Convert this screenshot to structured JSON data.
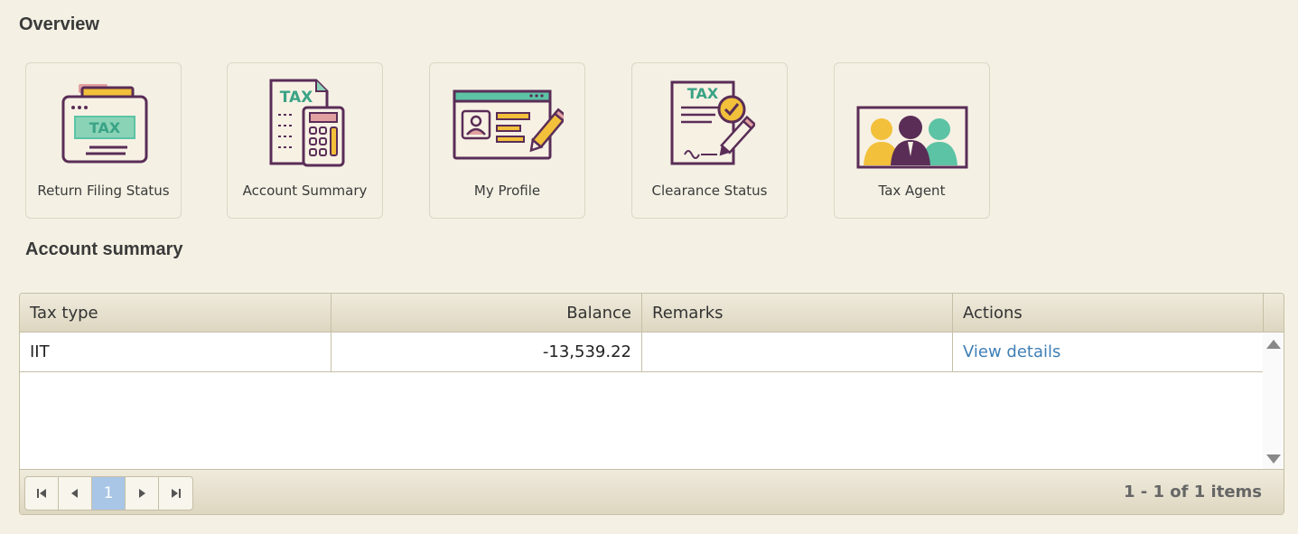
{
  "overview": {
    "title": "Overview",
    "tiles": [
      {
        "label": "Return Filing Status",
        "icon": "tax-folder-icon",
        "icon_text": "TAX"
      },
      {
        "label": "Account Summary",
        "icon": "tax-calculator-icon",
        "icon_text": "TAX"
      },
      {
        "label": "My Profile",
        "icon": "profile-card-icon"
      },
      {
        "label": "Clearance Status",
        "icon": "tax-clearance-icon",
        "icon_text": "TAX"
      },
      {
        "label": "Tax Agent",
        "icon": "tax-agent-icon"
      }
    ]
  },
  "account_summary": {
    "title": "Account summary",
    "columns": [
      "Tax type",
      "Balance",
      "Remarks",
      "Actions"
    ],
    "rows": [
      {
        "tax_type": "IIT",
        "balance": "-13,539.22",
        "remarks": "",
        "action": "View details"
      }
    ],
    "pager": {
      "current_page": "1",
      "info": "1 - 1 of 1 items"
    }
  },
  "colors": {
    "background": "#f4f1e4",
    "purple": "#5a2d57",
    "teal": "#5cc3a4",
    "yellow": "#f2c03a",
    "pink": "#e2a1a1",
    "link": "#3f7fb6",
    "active_page": "#a9c6e6"
  }
}
